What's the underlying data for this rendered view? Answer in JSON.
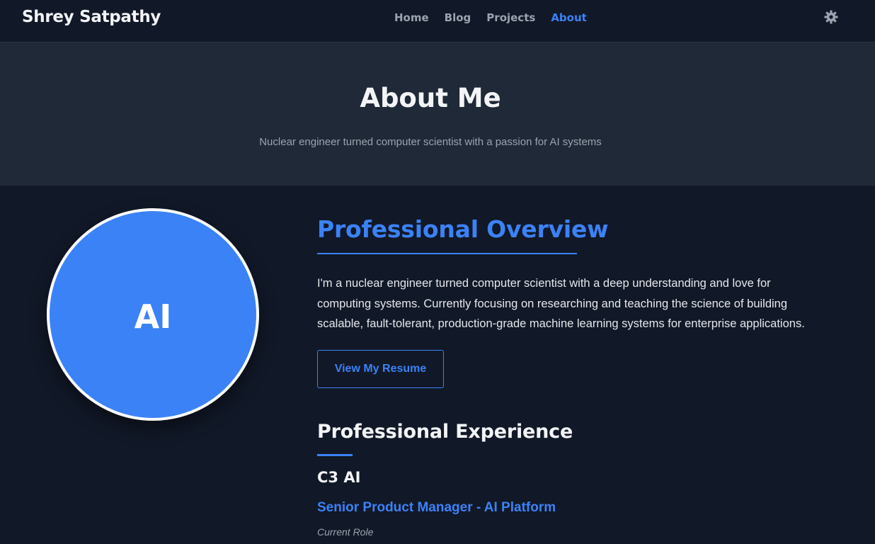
{
  "navbar": {
    "brand": "Shrey Satpathy",
    "links": [
      {
        "label": "Home",
        "active": false
      },
      {
        "label": "Blog",
        "active": false
      },
      {
        "label": "Projects",
        "active": false
      },
      {
        "label": "About",
        "active": true
      }
    ],
    "theme_toggle_icon": "gear-icon"
  },
  "hero": {
    "title": "About Me",
    "subtitle": "Nuclear engineer turned computer scientist with a passion for AI systems"
  },
  "avatar": {
    "text": "AI",
    "color": "#3b82f6"
  },
  "overview": {
    "title": "Professional Overview",
    "text": "I'm a nuclear engineer turned computer scientist with a deep understanding and love for computing systems. Currently focusing on researching and teaching the science of building scalable, fault-tolerant, production-grade machine learning systems for enterprise applications.",
    "resume_button": "View My Resume"
  },
  "experience": {
    "title": "Professional Experience",
    "items": [
      {
        "company": "C3 AI",
        "role": "Senior Product Manager - AI Platform",
        "period": "Current Role"
      }
    ]
  },
  "colors": {
    "background": "#111827",
    "hero_background": "#1f2937",
    "accent": "#3b82f6",
    "text": "#e5e7eb",
    "muted": "#9ca3af"
  }
}
